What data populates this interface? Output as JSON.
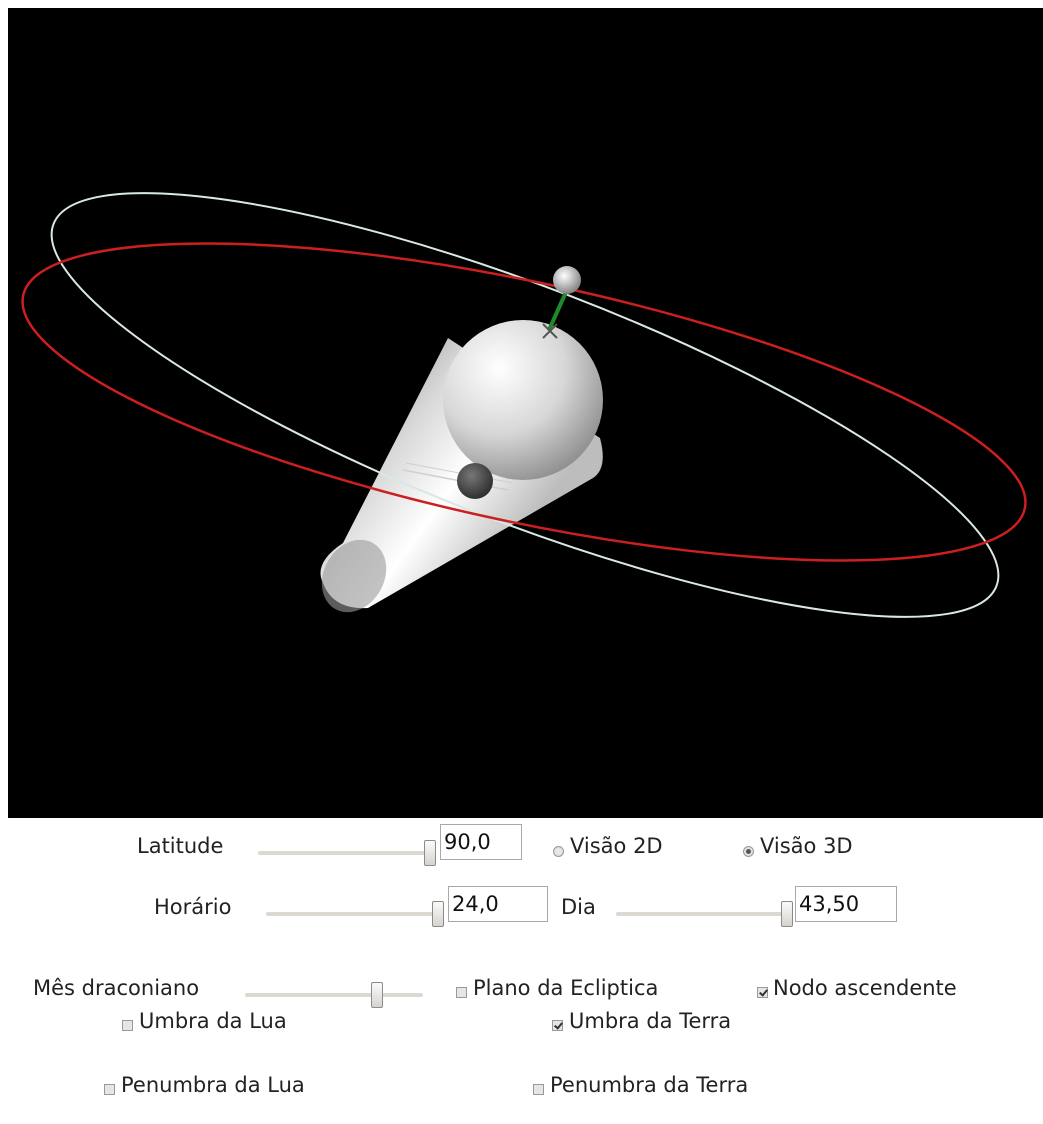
{
  "colors": {
    "background": "#000000",
    "ecliptic_orbit": "#cc1f1f",
    "moon_orbit": "#d9e8e4",
    "node_marker": "#1f8a2a",
    "shadow_cone": "#f0f0f0"
  },
  "controls": {
    "latitude": {
      "label": "Latitude",
      "value": "90,0",
      "slider_fraction": 1.0
    },
    "view_2d": {
      "label": "Visão 2D",
      "checked": false
    },
    "view_3d": {
      "label": "Visão 3D",
      "checked": true
    },
    "time": {
      "label": "Horário",
      "value": "24,0",
      "slider_fraction": 1.0
    },
    "day": {
      "label": "Dia",
      "value": "43,50",
      "slider_fraction": 1.0
    },
    "draconic_month": {
      "label": "Mês draconiano",
      "slider_fraction": 0.75
    },
    "ecliptic_plane": {
      "label": "Plano da Ecliptica",
      "checked": false
    },
    "ascending_node": {
      "label": "Nodo ascendente",
      "checked": true
    },
    "moon_umbra": {
      "label": "Umbra da Lua",
      "checked": false
    },
    "earth_umbra": {
      "label": "Umbra da Terra",
      "checked": true
    },
    "moon_penumbra": {
      "label": "Penumbra da Lua",
      "checked": false
    },
    "earth_penumbra": {
      "label": "Penumbra da Terra",
      "checked": false
    }
  }
}
